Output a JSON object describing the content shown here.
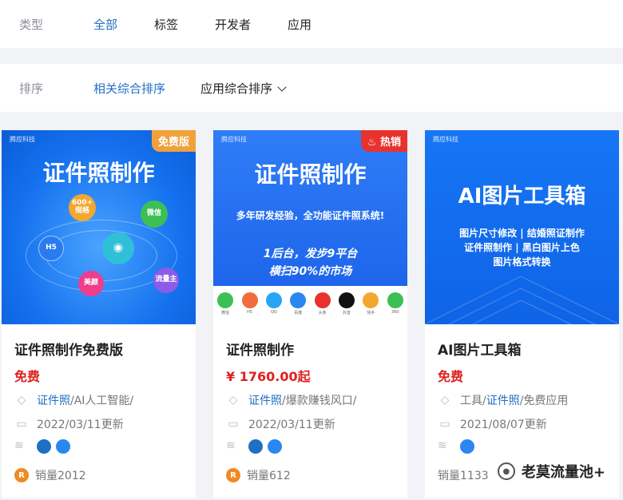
{
  "filters": {
    "type_label": "类型",
    "type_options": [
      "全部",
      "标签",
      "开发者",
      "应用"
    ],
    "sort_label": "排序",
    "sort_options": [
      "相关综合排序",
      "应用综合排序"
    ]
  },
  "colors": {
    "accent": "#1f6fc5",
    "price": "#e02020",
    "free_badge": "#f0a23a",
    "hot_badge": "#e8322d"
  },
  "cards": [
    {
      "image": {
        "brand": "腾应科技",
        "corner": "免费版",
        "headline": "证件照制作",
        "bubbles": [
          "600+\n规格",
          "微信",
          "H5",
          "美颜",
          "流量主"
        ]
      },
      "title": "证件照制作免费版",
      "price": "免费",
      "tags_link": "证件照",
      "tags_rest": "/AI人工智能/",
      "updated": "2022/03/11更新",
      "sales": "销量2012"
    },
    {
      "image": {
        "brand": "腾应科技",
        "corner": "热销",
        "headline": "证件照制作",
        "subline": "多年研发经验，全功能证件照系统!",
        "slogan1": "1后台，发步9平台",
        "slogan2": "横扫90%的市场",
        "apps": [
          "微信",
          "H5",
          "QQ",
          "百度",
          "头条",
          "抖音",
          "快手",
          "360"
        ]
      },
      "title": "证件照制作",
      "price": "¥ 1760.00起",
      "tags_link": "证件照",
      "tags_rest": "/爆款赚钱风口/",
      "updated": "2022/03/11更新",
      "sales": "销量612"
    },
    {
      "image": {
        "brand": "腾应科技",
        "headline": "AI图片工具箱",
        "line1": "图片尺寸修改 | 结婚照证制作",
        "line2": "证件照制作 | 黑白图片上色",
        "line3": "图片格式转换"
      },
      "title": "AI图片工具箱",
      "price": "免费",
      "tags_pre": "工具/",
      "tags_link": "证件照",
      "tags_rest": "/免费应用",
      "updated": "2021/08/07更新",
      "sales": "销量1133"
    }
  ],
  "watermark": "老莫流量池+"
}
